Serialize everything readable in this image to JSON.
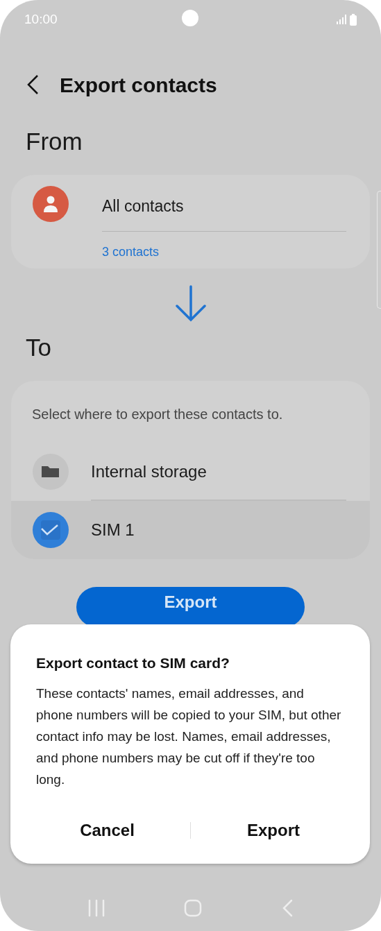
{
  "status_bar": {
    "time": "10:00"
  },
  "header": {
    "title": "Export contacts"
  },
  "from": {
    "heading": "From",
    "source": {
      "label": "All contacts",
      "count": "3 contacts"
    }
  },
  "to": {
    "heading": "To",
    "hint": "Select where to export these contacts to.",
    "options": [
      {
        "kind": "storage",
        "label": "Internal storage",
        "selected": false
      },
      {
        "kind": "sim",
        "label": "SIM 1",
        "selected": true
      }
    ]
  },
  "export_button": {
    "label": "Export"
  },
  "dialog": {
    "title": "Export contact to SIM card?",
    "message": "These contacts' names, email addresses, and phone numbers will be copied to your SIM, but other contact info may be lost. Names, email addresses, and phone numbers may be cut off if they're too long.",
    "buttons": [
      "Cancel",
      "Export"
    ]
  }
}
